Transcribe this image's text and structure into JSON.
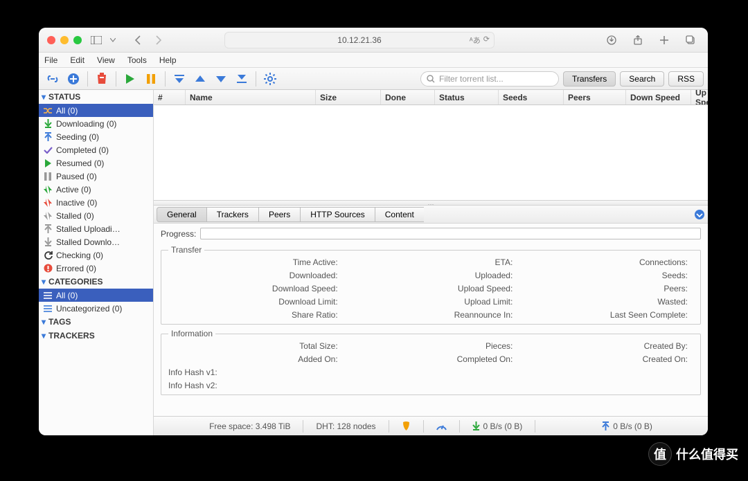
{
  "browser": {
    "address": "10.12.21.36"
  },
  "menus": [
    "File",
    "Edit",
    "View",
    "Tools",
    "Help"
  ],
  "filter": {
    "placeholder": "Filter torrent list..."
  },
  "view_tabs": [
    "Transfers",
    "Search",
    "RSS"
  ],
  "columns": {
    "num": "#",
    "name": "Name",
    "size": "Size",
    "done": "Done",
    "status": "Status",
    "seeds": "Seeds",
    "peers": "Peers",
    "down": "Down Speed",
    "up": "Up Speed"
  },
  "sidebar": {
    "status_header": "STATUS",
    "all": "All (0)",
    "downloading": "Downloading (0)",
    "seeding": "Seeding (0)",
    "completed": "Completed (0)",
    "resumed": "Resumed (0)",
    "paused": "Paused (0)",
    "active": "Active (0)",
    "inactive": "Inactive (0)",
    "stalled": "Stalled (0)",
    "stalled_up": "Stalled Uploadi…",
    "stalled_dl": "Stalled Downlo…",
    "checking": "Checking (0)",
    "errored": "Errored (0)",
    "categories_header": "CATEGORIES",
    "cat_all": "All (0)",
    "cat_uncat": "Uncategorized (0)",
    "tags_header": "TAGS",
    "trackers_header": "TRACKERS"
  },
  "detail_tabs": [
    "General",
    "Trackers",
    "Peers",
    "HTTP Sources",
    "Content"
  ],
  "details": {
    "progress_label": "Progress:",
    "transfer_legend": "Transfer",
    "info_legend": "Information",
    "time_active": "Time Active:",
    "eta": "ETA:",
    "connections": "Connections:",
    "downloaded": "Downloaded:",
    "uploaded": "Uploaded:",
    "seeds": "Seeds:",
    "dl_speed": "Download Speed:",
    "ul_speed": "Upload Speed:",
    "peers": "Peers:",
    "dl_limit": "Download Limit:",
    "ul_limit": "Upload Limit:",
    "wasted": "Wasted:",
    "ratio": "Share Ratio:",
    "reannounce": "Reannounce In:",
    "last_seen": "Last Seen Complete:",
    "total_size": "Total Size:",
    "pieces": "Pieces:",
    "created_by": "Created By:",
    "added_on": "Added On:",
    "completed_on": "Completed On:",
    "created_on": "Created On:",
    "hash1": "Info Hash v1:",
    "hash2": "Info Hash v2:"
  },
  "status": {
    "free_space": "Free space: 3.498 TiB",
    "dht": "DHT: 128 nodes",
    "down_rate": "0 B/s (0 B)",
    "up_rate": "0 B/s (0 B)"
  },
  "watermark": "什么值得买"
}
